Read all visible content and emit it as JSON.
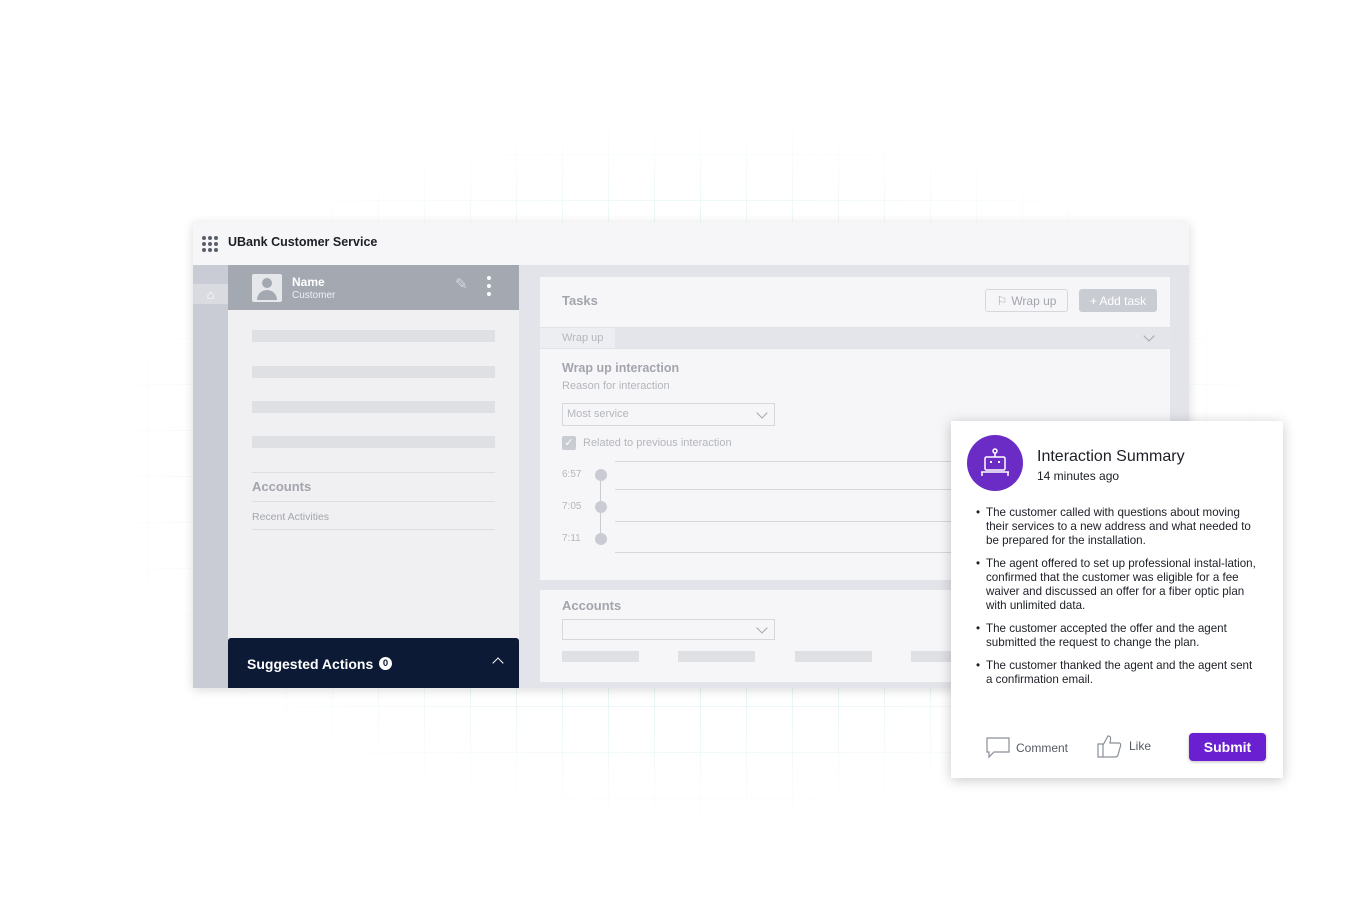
{
  "app": {
    "title": "UBank Customer Service"
  },
  "profile": {
    "name": "Name",
    "role": "Customer",
    "accounts_heading": "Accounts",
    "recent_label": "Recent Activities"
  },
  "suggested": {
    "label": "Suggested Actions",
    "count": "0"
  },
  "tasks": {
    "title": "Tasks",
    "wrap_button": "Wrap up",
    "add_button": "+ Add task",
    "wrap_row_label": "Wrap up",
    "wrap_interaction_title": "Wrap up interaction",
    "reason_label": "Reason for interaction",
    "reason_value": "Most service",
    "related_label": "Related to previous interaction",
    "timeline": [
      "6:57",
      "7:05",
      "7:11"
    ]
  },
  "accounts": {
    "title": "Accounts"
  },
  "summary": {
    "title": "Interaction Summary",
    "time": "14 minutes ago",
    "points": [
      "The customer called with questions about moving their services to a new address and what needed to be prepared for the installation.",
      "The agent offered to set up professional instal-lation, confirmed that the customer was eligible for a fee waiver and discussed an offer for a fiber optic plan with unlimited data.",
      "The customer accepted the offer and the agent submitted the request to change the plan.",
      "The customer thanked the agent and the agent sent a confirmation email."
    ],
    "comment_label": "Comment",
    "like_label": "Like",
    "submit_label": "Submit"
  },
  "colors": {
    "accent": "#6a1fd0",
    "bot_circle": "#6a2cc4",
    "suggested_bg": "#0c1a36"
  },
  "icons": [
    "apps-grid-icon",
    "home-icon",
    "user-icon",
    "pencil-icon",
    "kebab-icon",
    "chevron-up-icon",
    "flag-icon",
    "chevron-down-icon",
    "check-icon",
    "clock-icon",
    "bot-icon",
    "comment-icon",
    "thumbs-up-icon"
  ]
}
